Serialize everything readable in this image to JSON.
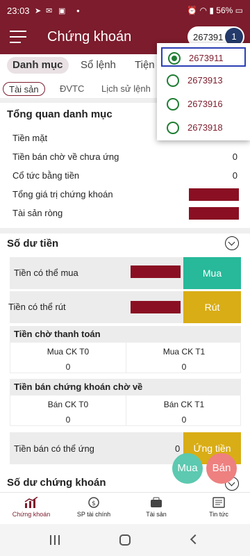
{
  "status_bar": {
    "time": "23:03",
    "battery": "56%"
  },
  "appbar": {
    "title": "Chứng khoán",
    "account_short": "267391",
    "account_count": "1"
  },
  "tabs": [
    "Danh mục",
    "Sổ lệnh",
    "Tiện í"
  ],
  "subtabs": [
    "Tài sản",
    "ĐVTC",
    "Lịch sử lệnh"
  ],
  "overview": {
    "title": "Tổng quan danh mục",
    "rows": [
      {
        "label": "Tiền mặt",
        "value": ""
      },
      {
        "label": "Tiền bán chờ về chưa ứng",
        "value": "0"
      },
      {
        "label": "Cổ tức bằng tiền",
        "value": "0"
      },
      {
        "label": "Tổng giá trị chứng khoán",
        "value": ""
      },
      {
        "label": "Tài sản ròng",
        "value": ""
      }
    ]
  },
  "cash": {
    "title": "Số dư tiền",
    "buyable_label": "Tiền có thể mua",
    "buy_button": "Mua",
    "withdrawable_label": "Tiền có thể rút",
    "withdraw_button": "Rút",
    "pending_title": "Tiền chờ thanh toán",
    "pending_cols": [
      "Mua CK T0",
      "Mua CK T1"
    ],
    "pending_vals": [
      "0",
      "0"
    ],
    "incoming_title": "Tiền bán chứng khoán chờ về",
    "incoming_cols": [
      "Bán CK T0",
      "Bán CK T1"
    ],
    "incoming_vals": [
      "0",
      "0"
    ],
    "advance_label": "Tiền bán có thể ứng",
    "advance_value": "0",
    "advance_button": "Ứng tiền"
  },
  "stock_balance": {
    "title": "Số dư chứng khoán"
  },
  "fab": {
    "buy": "Mua",
    "sell": "Bán"
  },
  "bottom_nav": [
    "Chứng khoán",
    "SP tài chính",
    "Tài sản",
    "Tin tức"
  ],
  "accounts": [
    "2673911",
    "2673913",
    "2673916",
    "2673918"
  ],
  "colors": {
    "brand": "#7c1c2c",
    "buy": "#27b99a",
    "withdraw": "#d9ad15",
    "redacted": "#8a0f22"
  }
}
